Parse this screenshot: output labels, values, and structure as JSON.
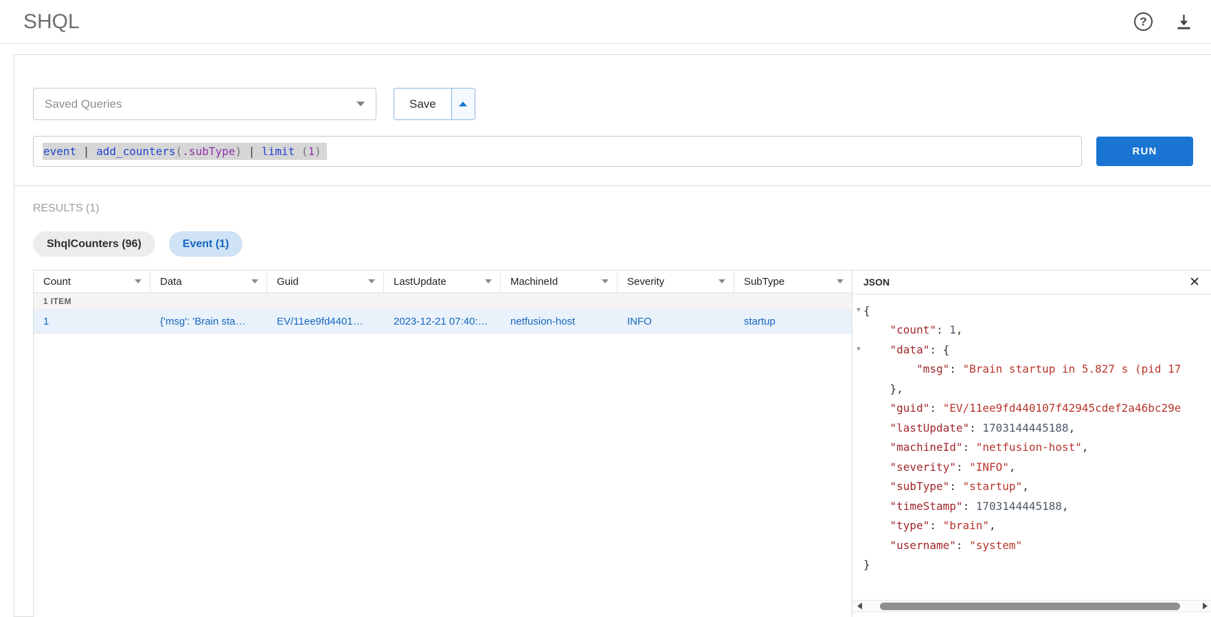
{
  "header": {
    "title": "SHQL",
    "help_icon": "?"
  },
  "colors": {
    "accent": "#1976d2",
    "link": "#1565c0",
    "active_tab_bg": "#d0e3f6",
    "row_bg": "#e9f2fb"
  },
  "query_builder": {
    "saved_queries_label": "Saved Queries",
    "save_label": "Save",
    "run_label": "RUN",
    "query_tokens": [
      {
        "text": "event",
        "type": "keyword"
      },
      {
        "text": " | ",
        "type": "pipe"
      },
      {
        "text": "add_counters",
        "type": "keyword"
      },
      {
        "text": "(",
        "type": "paren"
      },
      {
        "text": ".subType",
        "type": "field"
      },
      {
        "text": ")",
        "type": "paren"
      },
      {
        "text": " | ",
        "type": "pipe"
      },
      {
        "text": "limit",
        "type": "keyword"
      },
      {
        "text": " (",
        "type": "paren"
      },
      {
        "text": "1",
        "type": "field"
      },
      {
        "text": ")",
        "type": "paren"
      }
    ]
  },
  "results": {
    "label": "RESULTS (1)",
    "tabs": [
      {
        "label": "ShqlCounters (96)",
        "active": false
      },
      {
        "label": "Event (1)",
        "active": true
      }
    ]
  },
  "table": {
    "columns": [
      "Count",
      "Data",
      "Guid",
      "LastUpdate",
      "MachineId",
      "Severity",
      "SubType"
    ],
    "group_label": "1 ITEM",
    "rows": [
      [
        "1",
        "{'msg': 'Brain sta…",
        "EV/11ee9fd4401…",
        "2023-12-21 07:40:…",
        "netfusion-host",
        "INFO",
        "startup"
      ]
    ]
  },
  "json_panel": {
    "title": "JSON",
    "close_label": "✕",
    "lines": [
      {
        "arrow": true,
        "tokens": [
          [
            "brace",
            "{"
          ]
        ]
      },
      {
        "arrow": false,
        "tokens": [
          [
            "plain",
            "    "
          ],
          [
            "key",
            "\"count\""
          ],
          [
            "punc",
            ": "
          ],
          [
            "num",
            "1"
          ],
          [
            "punc",
            ","
          ]
        ]
      },
      {
        "arrow": true,
        "tokens": [
          [
            "plain",
            "    "
          ],
          [
            "key",
            "\"data\""
          ],
          [
            "punc",
            ": "
          ],
          [
            "brace",
            "{"
          ]
        ]
      },
      {
        "arrow": false,
        "tokens": [
          [
            "plain",
            "        "
          ],
          [
            "key",
            "\"msg\""
          ],
          [
            "punc",
            ": "
          ],
          [
            "str",
            "\"Brain startup in 5.827 s (pid 17"
          ]
        ]
      },
      {
        "arrow": false,
        "tokens": [
          [
            "plain",
            "    "
          ],
          [
            "brace",
            "}"
          ],
          [
            "punc",
            ","
          ]
        ]
      },
      {
        "arrow": false,
        "tokens": [
          [
            "plain",
            "    "
          ],
          [
            "key",
            "\"guid\""
          ],
          [
            "punc",
            ": "
          ],
          [
            "str",
            "\"EV/11ee9fd440107f42945cdef2a46bc29e"
          ]
        ]
      },
      {
        "arrow": false,
        "tokens": [
          [
            "plain",
            "    "
          ],
          [
            "key",
            "\"lastUpdate\""
          ],
          [
            "punc",
            ": "
          ],
          [
            "num",
            "1703144445188"
          ],
          [
            "punc",
            ","
          ]
        ]
      },
      {
        "arrow": false,
        "tokens": [
          [
            "plain",
            "    "
          ],
          [
            "key",
            "\"machineId\""
          ],
          [
            "punc",
            ": "
          ],
          [
            "str",
            "\"netfusion-host\""
          ],
          [
            "punc",
            ","
          ]
        ]
      },
      {
        "arrow": false,
        "tokens": [
          [
            "plain",
            "    "
          ],
          [
            "key",
            "\"severity\""
          ],
          [
            "punc",
            ": "
          ],
          [
            "str",
            "\"INFO\""
          ],
          [
            "punc",
            ","
          ]
        ]
      },
      {
        "arrow": false,
        "tokens": [
          [
            "plain",
            "    "
          ],
          [
            "key",
            "\"subType\""
          ],
          [
            "punc",
            ": "
          ],
          [
            "str",
            "\"startup\""
          ],
          [
            "punc",
            ","
          ]
        ]
      },
      {
        "arrow": false,
        "tokens": [
          [
            "plain",
            "    "
          ],
          [
            "key",
            "\"timeStamp\""
          ],
          [
            "punc",
            ": "
          ],
          [
            "num",
            "1703144445188"
          ],
          [
            "punc",
            ","
          ]
        ]
      },
      {
        "arrow": false,
        "tokens": [
          [
            "plain",
            "    "
          ],
          [
            "key",
            "\"type\""
          ],
          [
            "punc",
            ": "
          ],
          [
            "str",
            "\"brain\""
          ],
          [
            "punc",
            ","
          ]
        ]
      },
      {
        "arrow": false,
        "tokens": [
          [
            "plain",
            "    "
          ],
          [
            "key",
            "\"username\""
          ],
          [
            "punc",
            ": "
          ],
          [
            "str",
            "\"system\""
          ]
        ]
      },
      {
        "arrow": false,
        "tokens": [
          [
            "brace",
            "}"
          ]
        ]
      }
    ]
  }
}
